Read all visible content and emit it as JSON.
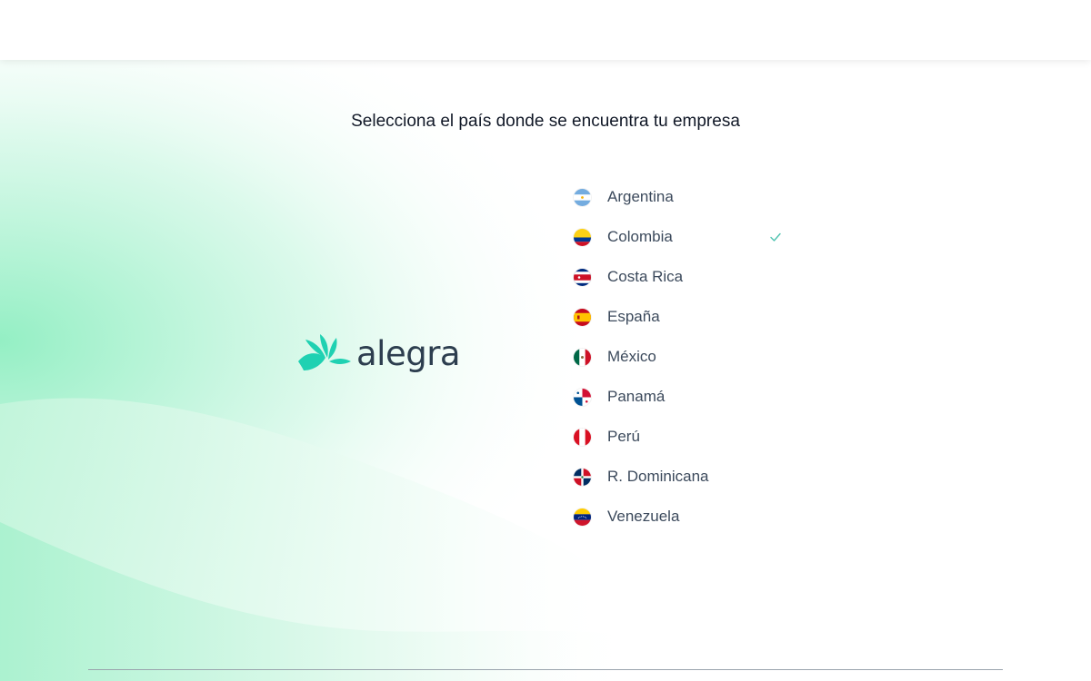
{
  "page": {
    "title": "Selecciona el país donde se encuentra tu empresa"
  },
  "logo": {
    "name": "alegra",
    "mark_color": "#1fd1b2",
    "text_color": "#2d3e4f"
  },
  "countries": [
    {
      "label": "Argentina",
      "flag": "argentina-flag-icon",
      "selected": false
    },
    {
      "label": "Colombia",
      "flag": "colombia-flag-icon",
      "selected": true
    },
    {
      "label": "Costa Rica",
      "flag": "costa-rica-flag-icon",
      "selected": false
    },
    {
      "label": "España",
      "flag": "spain-flag-icon",
      "selected": false
    },
    {
      "label": "México",
      "flag": "mexico-flag-icon",
      "selected": false
    },
    {
      "label": "Panamá",
      "flag": "panama-flag-icon",
      "selected": false
    },
    {
      "label": "Perú",
      "flag": "peru-flag-icon",
      "selected": false
    },
    {
      "label": "R. Dominicana",
      "flag": "dominican-republic-flag-icon",
      "selected": false
    },
    {
      "label": "Venezuela",
      "flag": "venezuela-flag-icon",
      "selected": false
    }
  ],
  "selection_icon": "check-icon",
  "colors": {
    "accent": "#1fd1b2",
    "check": "#4fc3b0",
    "background_gradient": "#9ff0c8"
  }
}
